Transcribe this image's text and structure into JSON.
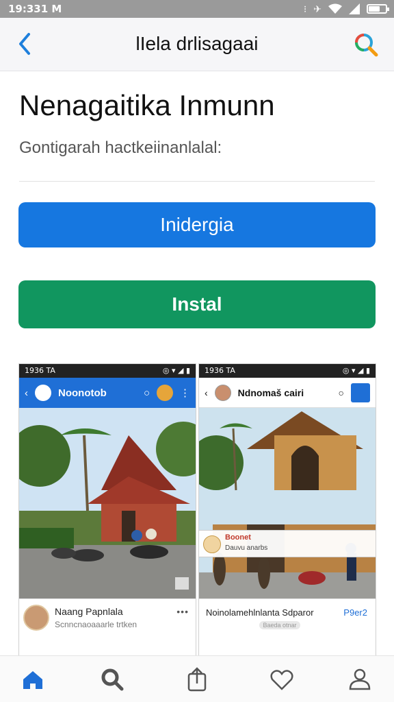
{
  "status_bar": {
    "time": "19:331 M"
  },
  "app_bar": {
    "title": "lIela drlisagaai",
    "back_icon": "back-chevron-icon",
    "search_icon": "search-icon"
  },
  "header": {
    "title": "Nenagaitika Inmunn",
    "subtitle": "Gontigarah hactkeiinanlalal:"
  },
  "buttons": {
    "primary_label": "Inidergia",
    "install_label": "Instal"
  },
  "colors": {
    "primary": "#1677e0",
    "install": "#11965f",
    "accent_blue": "#1f6fd6"
  },
  "screenshots": [
    {
      "status_time": "1936 TA",
      "status_right": "◎ ▾ ◢ ▮",
      "bar_title": "Noonotob",
      "footer_name": "Naang Papnlala",
      "footer_sub": "Scnncnaoaaarle trtken",
      "footer_more": "•••"
    },
    {
      "status_time": "1936 TA",
      "status_right": "◎ ▾ ◢ ▮",
      "bar_title": "Ndnomaš cairi",
      "overlay_name": "Boonet",
      "overlay_sub": "Dauvu anarbs",
      "footer_name": "Noinolamehlnlanta Sdparor",
      "footer_count": "P9er2",
      "footer_pill": "Baeda otnar"
    }
  ],
  "bottom_nav": [
    {
      "icon": "home-icon",
      "active": true
    },
    {
      "icon": "search-icon",
      "active": false
    },
    {
      "icon": "share-icon",
      "active": false
    },
    {
      "icon": "heart-icon",
      "active": false
    },
    {
      "icon": "profile-icon",
      "active": false
    }
  ]
}
